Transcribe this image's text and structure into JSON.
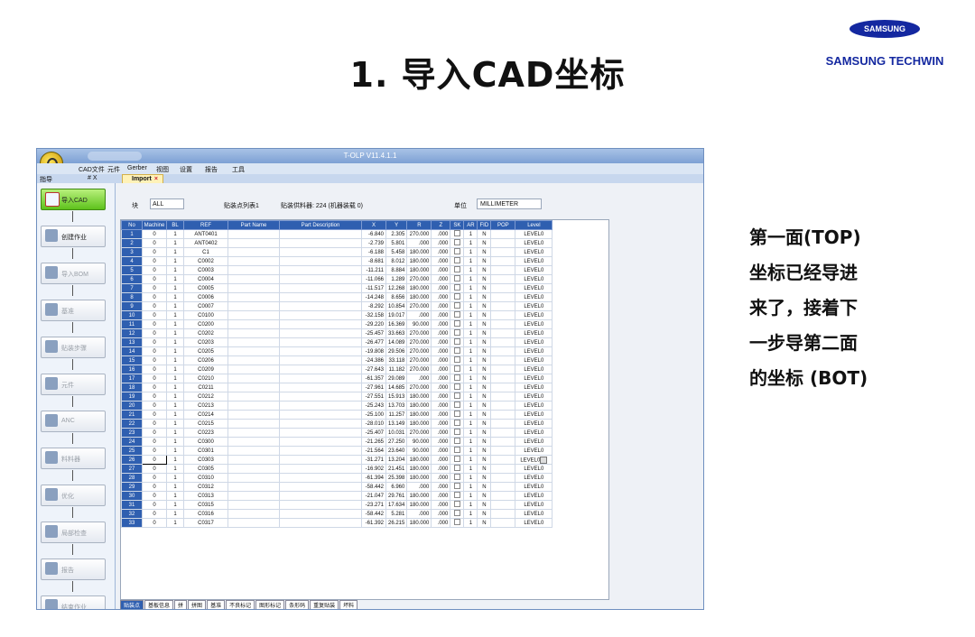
{
  "slide": {
    "title": "1. 导入CAD坐标",
    "logo_oval": "SAMSUNG",
    "logo_text": "SAMSUNG TECHWIN",
    "note_lines": [
      "第一面(TOP)",
      "坐标已经导进",
      "来了，接着下",
      "一步导第二面",
      "的坐标 (BOT)"
    ]
  },
  "app": {
    "window_title": "T-OLP V11.4.1.1",
    "menu": [
      "CAD文件",
      "元件",
      "Gerber",
      "视图",
      "设置",
      "报告",
      "工具"
    ],
    "nav_header": "指导",
    "nav_header_controls": "# X",
    "doc_tab": "Import",
    "nav_items": [
      "导入CAD",
      "创建作业",
      "导入BOM",
      "基准",
      "贴装步骤",
      "元件",
      "ANC",
      "料料器",
      "优化",
      "局部检查",
      "报告",
      "结束作业"
    ],
    "toolbar": {
      "block_label": "块",
      "block_value": "ALL",
      "list_label": "贴装点列表1",
      "stat": "贴装供料器: 224 (机器装载 0)",
      "unit_label": "单位",
      "unit_value": "MILLIMETER"
    },
    "columns": [
      "No",
      "Machine",
      "BL",
      "REF",
      "Part Name",
      "Part Description",
      "X",
      "Y",
      "R",
      "Z",
      "SK",
      "AR",
      "FID",
      "POP",
      "Level"
    ],
    "rows": [
      [
        "1",
        "0",
        "1",
        "ANT0401",
        "",
        "",
        "-6.840",
        "2.305",
        "270.000",
        ".000",
        "",
        "1",
        "N",
        "",
        "LEVEL0"
      ],
      [
        "2",
        "0",
        "1",
        "ANT0402",
        "",
        "",
        "-2.739",
        "5.801",
        ".000",
        ".000",
        "",
        "1",
        "N",
        "",
        "LEVEL0"
      ],
      [
        "3",
        "0",
        "1",
        "C1",
        "",
        "",
        "-6.188",
        "5.458",
        "180.000",
        ".000",
        "",
        "1",
        "N",
        "",
        "LEVEL0"
      ],
      [
        "4",
        "0",
        "1",
        "C0002",
        "",
        "",
        "-8.681",
        "8.012",
        "180.000",
        ".000",
        "",
        "1",
        "N",
        "",
        "LEVEL0"
      ],
      [
        "5",
        "0",
        "1",
        "C0003",
        "",
        "",
        "-11.211",
        "8.884",
        "180.000",
        ".000",
        "",
        "1",
        "N",
        "",
        "LEVEL0"
      ],
      [
        "6",
        "0",
        "1",
        "C0004",
        "",
        "",
        "-11.066",
        "1.289",
        "270.000",
        ".000",
        "",
        "1",
        "N",
        "",
        "LEVEL0"
      ],
      [
        "7",
        "0",
        "1",
        "C0005",
        "",
        "",
        "-11.517",
        "12.268",
        "180.000",
        ".000",
        "",
        "1",
        "N",
        "",
        "LEVEL0"
      ],
      [
        "8",
        "0",
        "1",
        "C0006",
        "",
        "",
        "-14.248",
        "8.656",
        "180.000",
        ".000",
        "",
        "1",
        "N",
        "",
        "LEVEL0"
      ],
      [
        "9",
        "0",
        "1",
        "C0007",
        "",
        "",
        "-8.292",
        "10.854",
        "270.000",
        ".000",
        "",
        "1",
        "N",
        "",
        "LEVEL0"
      ],
      [
        "10",
        "0",
        "1",
        "C0100",
        "",
        "",
        "-32.158",
        "19.017",
        ".000",
        ".000",
        "",
        "1",
        "N",
        "",
        "LEVEL0"
      ],
      [
        "11",
        "0",
        "1",
        "C0200",
        "",
        "",
        "-29.220",
        "16.369",
        "90.000",
        ".000",
        "",
        "1",
        "N",
        "",
        "LEVEL0"
      ],
      [
        "12",
        "0",
        "1",
        "C0202",
        "",
        "",
        "-25.457",
        "33.663",
        "270.000",
        ".000",
        "",
        "1",
        "N",
        "",
        "LEVEL0"
      ],
      [
        "13",
        "0",
        "1",
        "C0203",
        "",
        "",
        "-26.477",
        "14.089",
        "270.000",
        ".000",
        "",
        "1",
        "N",
        "",
        "LEVEL0"
      ],
      [
        "14",
        "0",
        "1",
        "C0205",
        "",
        "",
        "-19.808",
        "29.506",
        "270.000",
        ".000",
        "",
        "1",
        "N",
        "",
        "LEVEL0"
      ],
      [
        "15",
        "0",
        "1",
        "C0206",
        "",
        "",
        "-24.386",
        "33.118",
        "270.000",
        ".000",
        "",
        "1",
        "N",
        "",
        "LEVEL0"
      ],
      [
        "16",
        "0",
        "1",
        "C0209",
        "",
        "",
        "-27.643",
        "11.182",
        "270.000",
        ".000",
        "",
        "1",
        "N",
        "",
        "LEVEL0"
      ],
      [
        "17",
        "0",
        "1",
        "C0210",
        "",
        "",
        "-61.357",
        "29.089",
        ".000",
        ".000",
        "",
        "1",
        "N",
        "",
        "LEVEL0"
      ],
      [
        "18",
        "0",
        "1",
        "C0211",
        "",
        "",
        "-27.961",
        "14.685",
        "270.000",
        ".000",
        "",
        "1",
        "N",
        "",
        "LEVEL0"
      ],
      [
        "19",
        "0",
        "1",
        "C0212",
        "",
        "",
        "-27.551",
        "15.913",
        "180.000",
        ".000",
        "",
        "1",
        "N",
        "",
        "LEVEL0"
      ],
      [
        "20",
        "0",
        "1",
        "C0213",
        "",
        "",
        "-25.243",
        "13.703",
        "180.000",
        ".000",
        "",
        "1",
        "N",
        "",
        "LEVEL0"
      ],
      [
        "21",
        "0",
        "1",
        "C0214",
        "",
        "",
        "-25.100",
        "11.257",
        "180.000",
        ".000",
        "",
        "1",
        "N",
        "",
        "LEVEL0"
      ],
      [
        "22",
        "0",
        "1",
        "C0215",
        "",
        "",
        "-28.010",
        "13.149",
        "180.000",
        ".000",
        "",
        "1",
        "N",
        "",
        "LEVEL0"
      ],
      [
        "23",
        "0",
        "1",
        "C0223",
        "",
        "",
        "-25.407",
        "10.031",
        "270.000",
        ".000",
        "",
        "1",
        "N",
        "",
        "LEVEL0"
      ],
      [
        "24",
        "0",
        "1",
        "C0300",
        "",
        "",
        "-21.265",
        "27.250",
        "90.000",
        ".000",
        "",
        "1",
        "N",
        "",
        "LEVEL0"
      ],
      [
        "25",
        "0",
        "1",
        "C0301",
        "",
        "",
        "-21.564",
        "23.640",
        "90.000",
        ".000",
        "",
        "1",
        "N",
        "",
        "LEVEL0"
      ],
      [
        "26",
        "0",
        "1",
        "C0303",
        "",
        "",
        "-31.271",
        "13.204",
        "180.000",
        ".000",
        "",
        "1",
        "N",
        "",
        "LEVEL0"
      ],
      [
        "27",
        "0",
        "1",
        "C0305",
        "",
        "",
        "-16.902",
        "21.451",
        "180.000",
        ".000",
        "",
        "1",
        "N",
        "",
        "LEVEL0"
      ],
      [
        "28",
        "0",
        "1",
        "C0310",
        "",
        "",
        "-61.394",
        "25.398",
        "180.000",
        ".000",
        "",
        "1",
        "N",
        "",
        "LEVEL0"
      ],
      [
        "29",
        "0",
        "1",
        "C0312",
        "",
        "",
        "-58.442",
        "6.960",
        ".000",
        ".000",
        "",
        "1",
        "N",
        "",
        "LEVEL0"
      ],
      [
        "30",
        "0",
        "1",
        "C0313",
        "",
        "",
        "-21.047",
        "29.761",
        "180.000",
        ".000",
        "",
        "1",
        "N",
        "",
        "LEVEL0"
      ],
      [
        "31",
        "0",
        "1",
        "C0315",
        "",
        "",
        "-23.271",
        "17.634",
        "180.000",
        ".000",
        "",
        "1",
        "N",
        "",
        "LEVEL0"
      ],
      [
        "32",
        "0",
        "1",
        "C0316",
        "",
        "",
        "-58.442",
        "5.281",
        ".000",
        ".000",
        "",
        "1",
        "N",
        "",
        "LEVEL0"
      ],
      [
        "33",
        "0",
        "1",
        "C0317",
        "",
        "",
        "-61.392",
        "26.215",
        "180.000",
        ".000",
        "",
        "1",
        "N",
        "",
        "LEVEL0"
      ]
    ],
    "selected_row": 25,
    "sheet_tabs": [
      "贴装点",
      "基板信息",
      "拼",
      "拼图",
      "基准",
      "不良标记",
      "图形标记",
      "条形码",
      "重复贴装",
      "坏料"
    ],
    "active_sheet": 0
  }
}
